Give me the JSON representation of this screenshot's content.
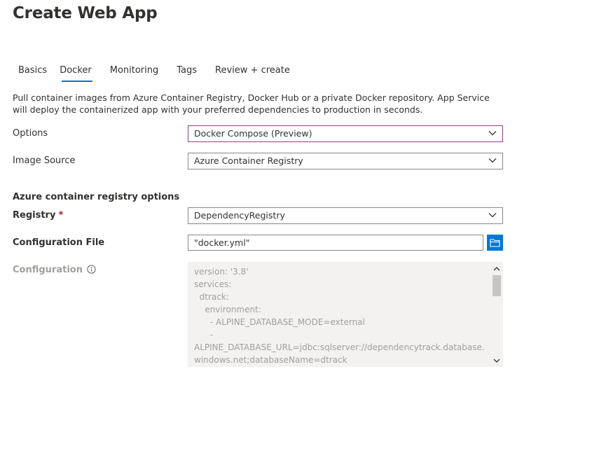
{
  "page": {
    "title": "Create Web App"
  },
  "tabs": [
    {
      "label": "Basics",
      "active": false
    },
    {
      "label": "Docker",
      "active": true
    },
    {
      "label": "Monitoring",
      "active": false
    },
    {
      "label": "Tags",
      "active": false
    },
    {
      "label": "Review + create",
      "active": false
    }
  ],
  "description": "Pull container images from Azure Container Registry, Docker Hub or a private Docker repository. App Service will deploy the containerized app with your preferred dependencies to production in seconds.",
  "form": {
    "options": {
      "label": "Options",
      "value": "Docker Compose (Preview)"
    },
    "image_source": {
      "label": "Image Source",
      "value": "Azure Container Registry"
    },
    "acr_section_heading": "Azure container registry options",
    "registry": {
      "label": "Registry",
      "required_marker": "*",
      "value": "DependencyRegistry"
    },
    "configuration_file": {
      "label": "Configuration File",
      "value": "\"docker.yml\""
    },
    "configuration": {
      "label": "Configuration",
      "info_icon": "info-icon",
      "content": "version: '3.8'\nservices:\n  dtrack:\n    environment:\n      - ALPINE_DATABASE_MODE=external\n      -\nALPINE_DATABASE_URL=jdbc:sqlserver://dependencytrack.database.windows.net;databaseName=dtrack"
    }
  },
  "icons": {
    "dropdown": "chevron-down-icon",
    "browse": "folder-icon",
    "scroll_up": "chevron-up-icon",
    "scroll_down": "chevron-down-icon"
  },
  "colors": {
    "accent": "#0078d4",
    "focus_border": "#8a3f8f",
    "required": "#a4262c",
    "disabled_text": "#a19f9d",
    "readonly_bg": "#f3f2f1"
  }
}
